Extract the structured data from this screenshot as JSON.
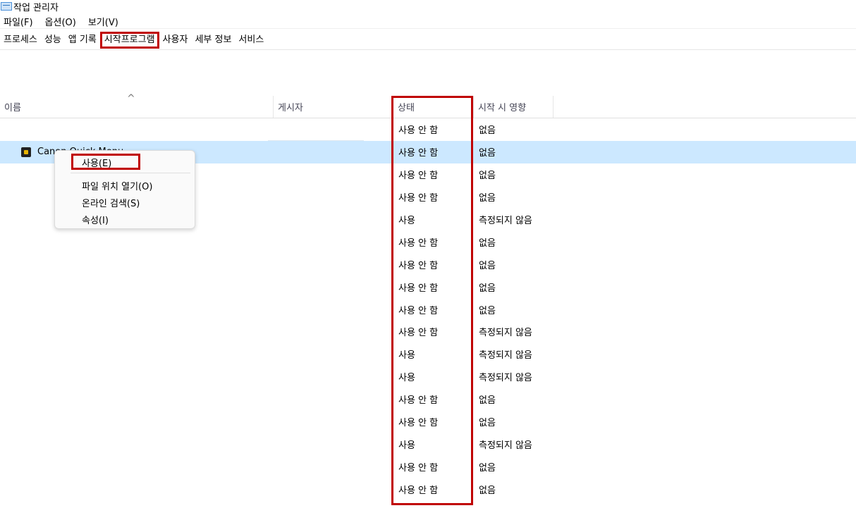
{
  "window": {
    "title": "작업 관리자"
  },
  "menubar": {
    "items": [
      "파일(F)",
      "옵션(O)",
      "보기(V)"
    ]
  },
  "tabs": [
    "프로세스",
    "성능",
    "앱 기록",
    "시작프로그램",
    "사용자",
    "세부 정보",
    "서비스"
  ],
  "active_tab": "시작프로그램",
  "columns": {
    "name": "이름",
    "publisher": "게시자",
    "status": "상태",
    "impact": "시작 시 영향",
    "sort_caret": "^"
  },
  "rows": [
    {
      "name": "",
      "status": "사용 안 함",
      "impact": "없음"
    },
    {
      "name": "Canon Quick Menu",
      "status": "사용 안 함",
      "impact": "없음",
      "selected": true
    },
    {
      "name": "",
      "status": "사용 안 함",
      "impact": "없음"
    },
    {
      "name": "",
      "status": "사용 안 함",
      "impact": "없음"
    },
    {
      "name": "",
      "status": "사용",
      "impact": "측정되지 않음"
    },
    {
      "name": "",
      "status": "사용 안 함",
      "impact": "없음"
    },
    {
      "name": "",
      "status": "사용 안 함",
      "impact": "없음"
    },
    {
      "name": "",
      "status": "사용 안 함",
      "impact": "없음"
    },
    {
      "name": "",
      "status": "사용 안 함",
      "impact": "없음"
    },
    {
      "name": "",
      "status": "사용 안 함",
      "impact": "측정되지 않음"
    },
    {
      "name": "",
      "status": "사용",
      "impact": "측정되지 않음"
    },
    {
      "name": "",
      "status": "사용",
      "impact": "측정되지 않음"
    },
    {
      "name": "",
      "status": "사용 안 함",
      "impact": "없음"
    },
    {
      "name": "",
      "status": "사용 안 함",
      "impact": "없음"
    },
    {
      "name": "",
      "status": "사용",
      "impact": "측정되지 않음"
    },
    {
      "name": "",
      "status": "사용 안 함",
      "impact": "없음"
    },
    {
      "name": "",
      "status": "사용 안 함",
      "impact": "없음"
    }
  ],
  "context_menu": {
    "enable": "사용(E)",
    "open_location": "파일 위치 열기(O)",
    "search_online": "온라인 검색(S)",
    "properties": "속성(I)"
  },
  "colors": {
    "highlight_border": "#c00000",
    "selected_row": "#cce8ff"
  }
}
